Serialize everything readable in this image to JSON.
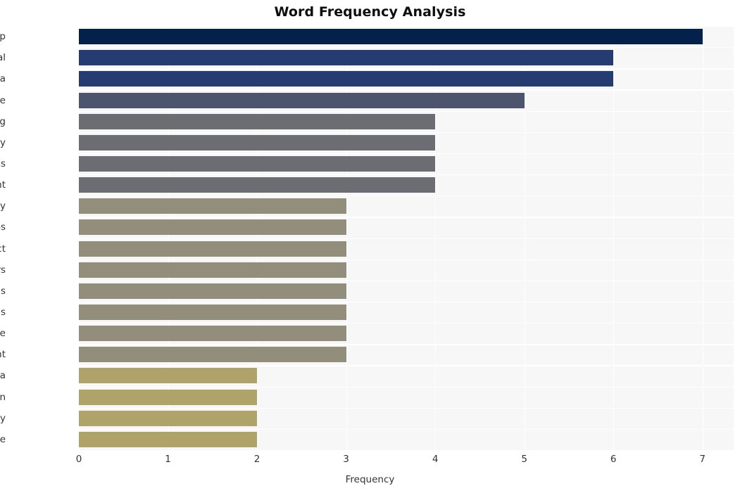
{
  "chart_data": {
    "type": "bar",
    "orientation": "horizontal",
    "title": "Word Frequency Analysis",
    "xlabel": "Frequency",
    "ylabel": "",
    "categories": [
      "app",
      "social",
      "media",
      "age",
      "zuckerberg",
      "testimony",
      "congress",
      "parent",
      "company",
      "ceos",
      "protect",
      "users",
      "teens",
      "metas",
      "store",
      "want",
      "meta",
      "verification",
      "responsibility",
      "apple"
    ],
    "values": [
      7,
      6,
      6,
      5,
      4,
      4,
      4,
      4,
      3,
      3,
      3,
      3,
      3,
      3,
      3,
      3,
      2,
      2,
      2,
      2
    ],
    "bar_colors": [
      "#04214c",
      "#243c72",
      "#243c72",
      "#4d556e",
      "#6b6d72",
      "#6b6d72",
      "#6b6d72",
      "#6b6d72",
      "#938d7b",
      "#938d7b",
      "#938d7b",
      "#938d7b",
      "#938d7b",
      "#938d7b",
      "#938d7b",
      "#938d7b",
      "#b0a36a",
      "#b0a36a",
      "#b0a36a",
      "#b0a36a"
    ],
    "xlim": [
      0,
      7.35
    ],
    "xticks": [
      0,
      1,
      2,
      3,
      4,
      5,
      6,
      7
    ],
    "xtick_labels": [
      "0",
      "1",
      "2",
      "3",
      "4",
      "5",
      "6",
      "7"
    ],
    "grid": true,
    "grid_color": "#ffffff",
    "plot_background": "#f7f7f7",
    "figure_background": "#ffffff",
    "legend": null
  }
}
